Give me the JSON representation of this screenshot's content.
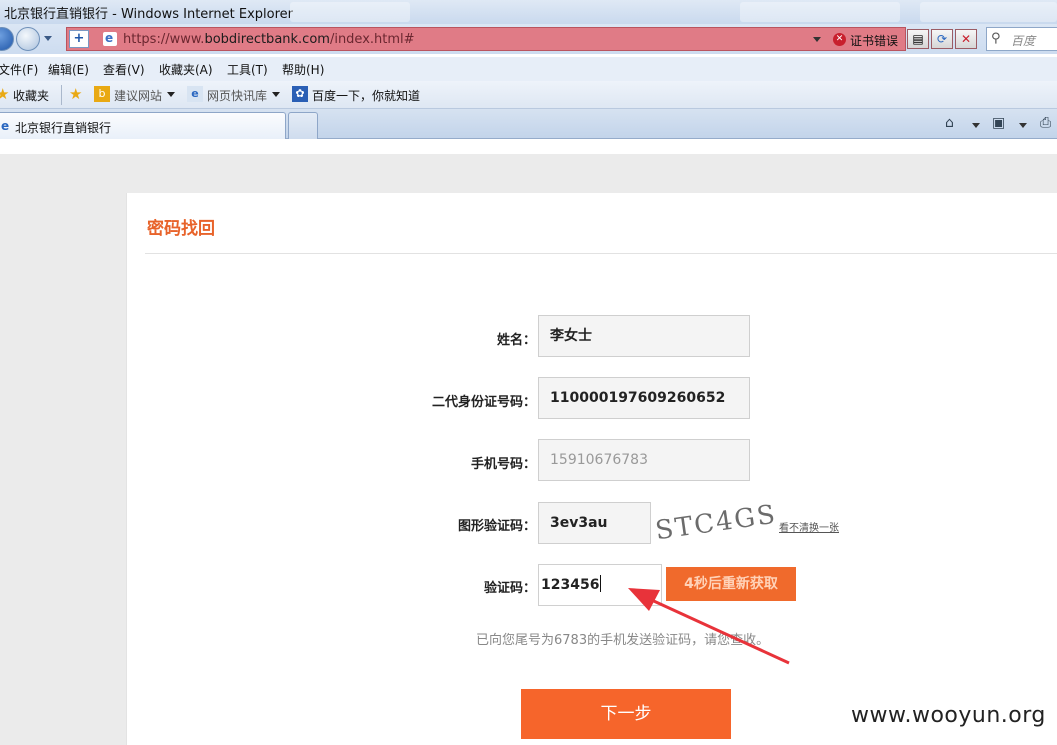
{
  "window": {
    "title": "北京银行直销银行 - Windows Internet Explorer"
  },
  "address_bar": {
    "url_prefix": "https://www.",
    "url_domain": "bobdirectbank.com",
    "url_path": "/index.html#",
    "cert_error": "证书错误"
  },
  "search": {
    "placeholder": "百度"
  },
  "menu": {
    "file": "文件(F)",
    "edit": "编辑(E)",
    "view": "查看(V)",
    "favorites": "收藏夹(A)",
    "tools": "工具(T)",
    "help": "帮助(H)"
  },
  "favbar": {
    "favorites": "收藏夹",
    "suggested_sites": "建议网站",
    "web_slices": "网页快讯库",
    "baidu": "百度一下，你就知道"
  },
  "tab": {
    "label": "北京银行直销银行"
  },
  "form": {
    "heading": "密码找回",
    "name_label": "姓名：",
    "name_value": "李女士",
    "id_label": "二代身份证号码：",
    "id_value": "110000197609260652",
    "phone_label": "手机号码：",
    "phone_value": "15910676783",
    "captcha_label": "图形验证码：",
    "captcha_value": "3ev3au",
    "captcha_image_text": "STC4GS",
    "captcha_refresh": "看不清换一张",
    "sms_label": "验证码：",
    "sms_value": "123456",
    "countdown_button": "4秒后重新获取",
    "notice": "已向您尾号为6783的手机发送验证码，请您查收。",
    "next_button": "下一步"
  },
  "watermark": "www.wooyun.org",
  "colors": {
    "accent": "#f6652b",
    "address_error": "#e07b86"
  }
}
